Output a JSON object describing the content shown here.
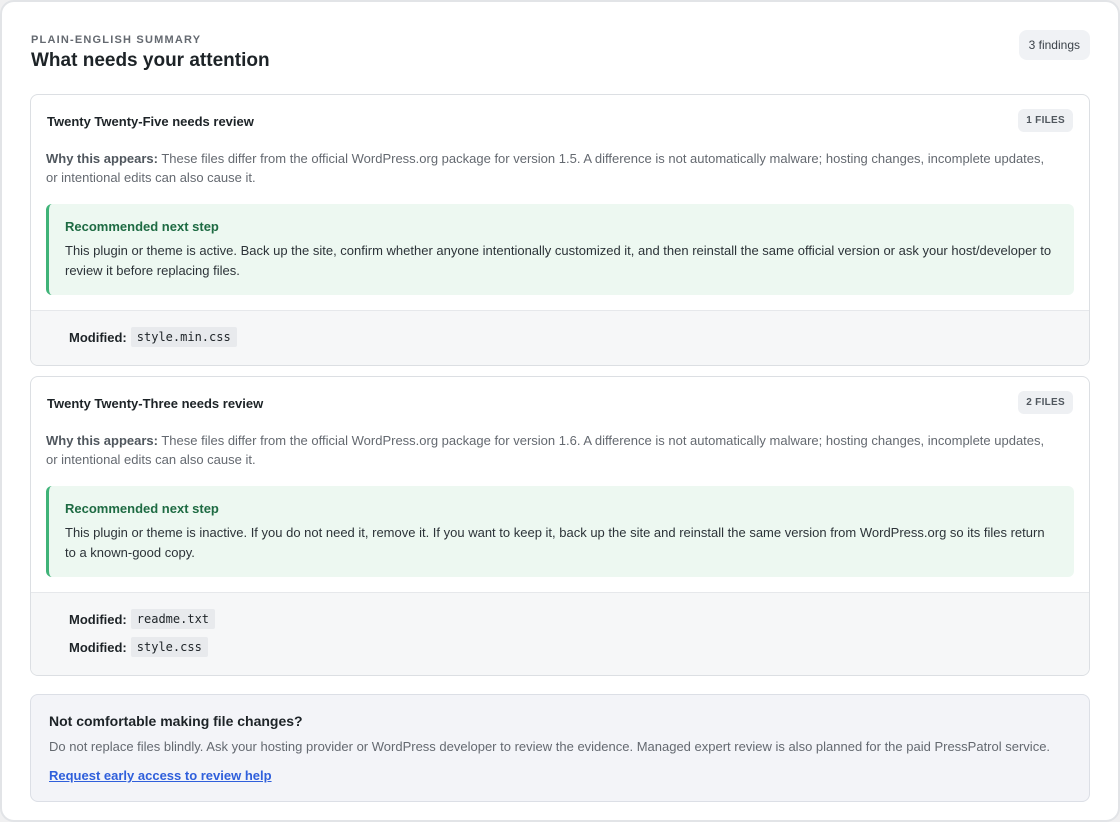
{
  "summary": {
    "eyebrow": "PLAIN-ENGLISH SUMMARY",
    "title": "What needs your attention",
    "count": "3 findings"
  },
  "findings": [
    {
      "title": "Twenty Twenty-Five needs review",
      "files_badge": "1 FILES",
      "why_label": "Why this appears:",
      "why_text": " These files differ from the official WordPress.org package for version 1.5. A difference is not automatically malware; hosting changes, incomplete updates, or intentional edits can also cause it.",
      "rec_title": "Recommended next step",
      "rec_text": "This plugin or theme is active. Back up the site, confirm whether anyone intentionally customized it, and then reinstall the same official version or ask your host/developer to review it before replacing files.",
      "files": [
        {
          "label": "Modified:",
          "name": "style.min.css"
        }
      ]
    },
    {
      "title": "Twenty Twenty-Three needs review",
      "files_badge": "2 FILES",
      "why_label": "Why this appears:",
      "why_text": " These files differ from the official WordPress.org package for version 1.6. A difference is not automatically malware; hosting changes, incomplete updates, or intentional edits can also cause it.",
      "rec_title": "Recommended next step",
      "rec_text": "This plugin or theme is inactive. If you do not need it, remove it. If you want to keep it, back up the site and reinstall the same version from WordPress.org so its files return to a known-good copy.",
      "files": [
        {
          "label": "Modified:",
          "name": "readme.txt"
        },
        {
          "label": "Modified:",
          "name": "style.css"
        }
      ]
    }
  ],
  "help": {
    "title": "Not comfortable making file changes?",
    "text": "Do not replace files blindly. Ask your hosting provider or WordPress developer to review the evidence. Managed expert review is also planned for the paid PressPatrol service.",
    "link": "Request early access to review help"
  },
  "colors": {
    "accent_green": "#3fb378",
    "link_blue": "#2f5fdb"
  }
}
